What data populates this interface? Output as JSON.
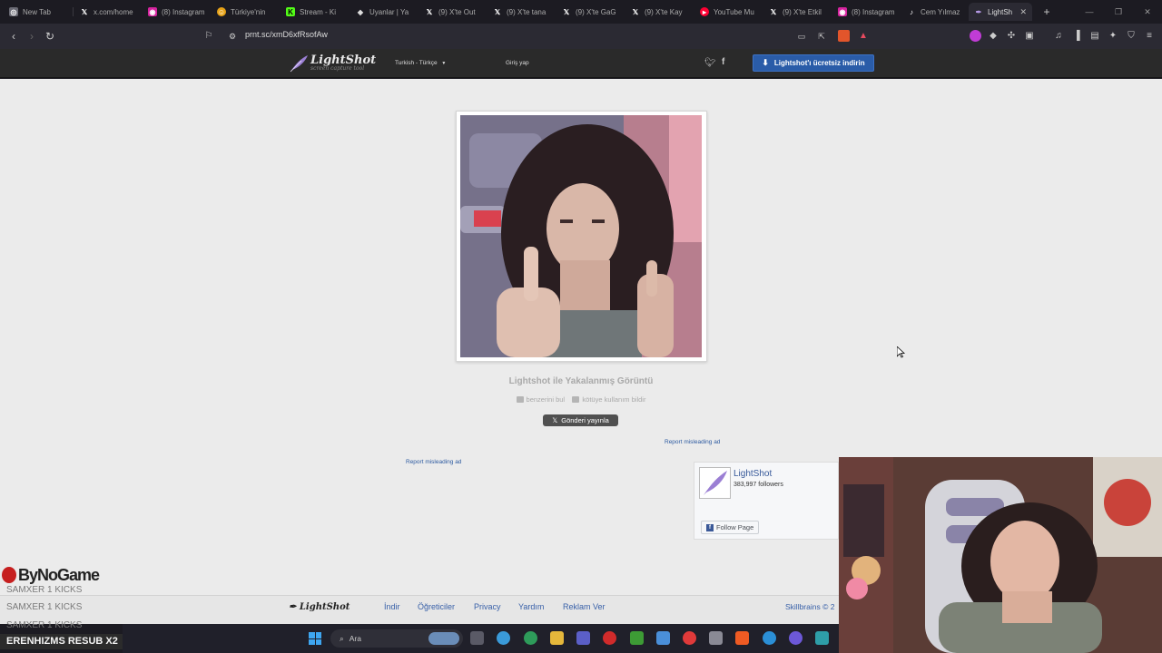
{
  "browser": {
    "tabs": [
      {
        "label": "New Tab",
        "icon": "globe-icon",
        "color": "#6b6b75"
      },
      {
        "label": "x.com/home",
        "icon": "x-icon",
        "color": "#000000"
      },
      {
        "label": "(8) Instagram",
        "icon": "instagram-icon",
        "color": "#d6249f"
      },
      {
        "label": "Türkiye'nin",
        "icon": "smile-icon",
        "color": "#e8a317"
      },
      {
        "label": "Stream - Ki",
        "icon": "kick-icon",
        "color": "#53fc18"
      },
      {
        "label": "Uyanlar | Ya",
        "icon": "diamond-icon",
        "color": "#dddddd"
      },
      {
        "label": "(9) X'te Out",
        "icon": "x-icon",
        "color": "#000000"
      },
      {
        "label": "(9) X'te tana",
        "icon": "x-icon",
        "color": "#000000"
      },
      {
        "label": "(9) X'te GaG",
        "icon": "x-icon",
        "color": "#000000"
      },
      {
        "label": "(9) X'te Kay",
        "icon": "x-icon",
        "color": "#000000"
      },
      {
        "label": "YouTube Mu",
        "icon": "youtube-icon",
        "color": "#ff0033"
      },
      {
        "label": "(9) X'te Etkil",
        "icon": "x-icon",
        "color": "#000000"
      },
      {
        "label": "(8) Instagram",
        "icon": "instagram-icon",
        "color": "#d6249f"
      },
      {
        "label": "Cem Yılmaz",
        "icon": "tiktok-icon",
        "color": "#111111"
      },
      {
        "label": "LightSh",
        "icon": "lightshot-icon",
        "color": "#7a5ab8"
      }
    ],
    "url": "prnt.sc/xmD6xfRsofAw"
  },
  "header": {
    "logo_text": "LightShot",
    "logo_tagline": "screen capture tool",
    "language": "Turkish - Türkçe",
    "login": "Giriş yap",
    "download_button": "Lightshot'ı ücretsiz indirin"
  },
  "main": {
    "caption": "Lightshot ile Yakalanmış Görüntü",
    "find_similar": "benzerini bul",
    "report_abuse": "kötüye kullanım bildir",
    "share_button": "Gönderi yayınla",
    "report_ad_1": "Report misleading ad",
    "report_ad_2": "Report misleading ad"
  },
  "fb_widget": {
    "page_name": "LightShot",
    "followers": "383,997 followers",
    "follow_button": "Follow Page"
  },
  "footer": {
    "logo_text": "LightShot",
    "links": [
      "İndir",
      "Öğreticiler",
      "Privacy",
      "Yardım",
      "Reklam Ver"
    ],
    "copyright": "Skillbrains © 2"
  },
  "overlay": {
    "brand": "ByNoGame",
    "kick_lines": [
      "SAMXER 1 KICKS",
      "SAMXER 1 KICKS",
      "SAMXER 1 KICKS"
    ],
    "resub": "ERENHIZMS  RESUB X2"
  },
  "taskbar": {
    "search_label": "Ara"
  },
  "colors": {
    "accent_blue": "#2a5ca8",
    "page_bg": "#ebebeb",
    "header_bg": "#2a2a2a"
  }
}
